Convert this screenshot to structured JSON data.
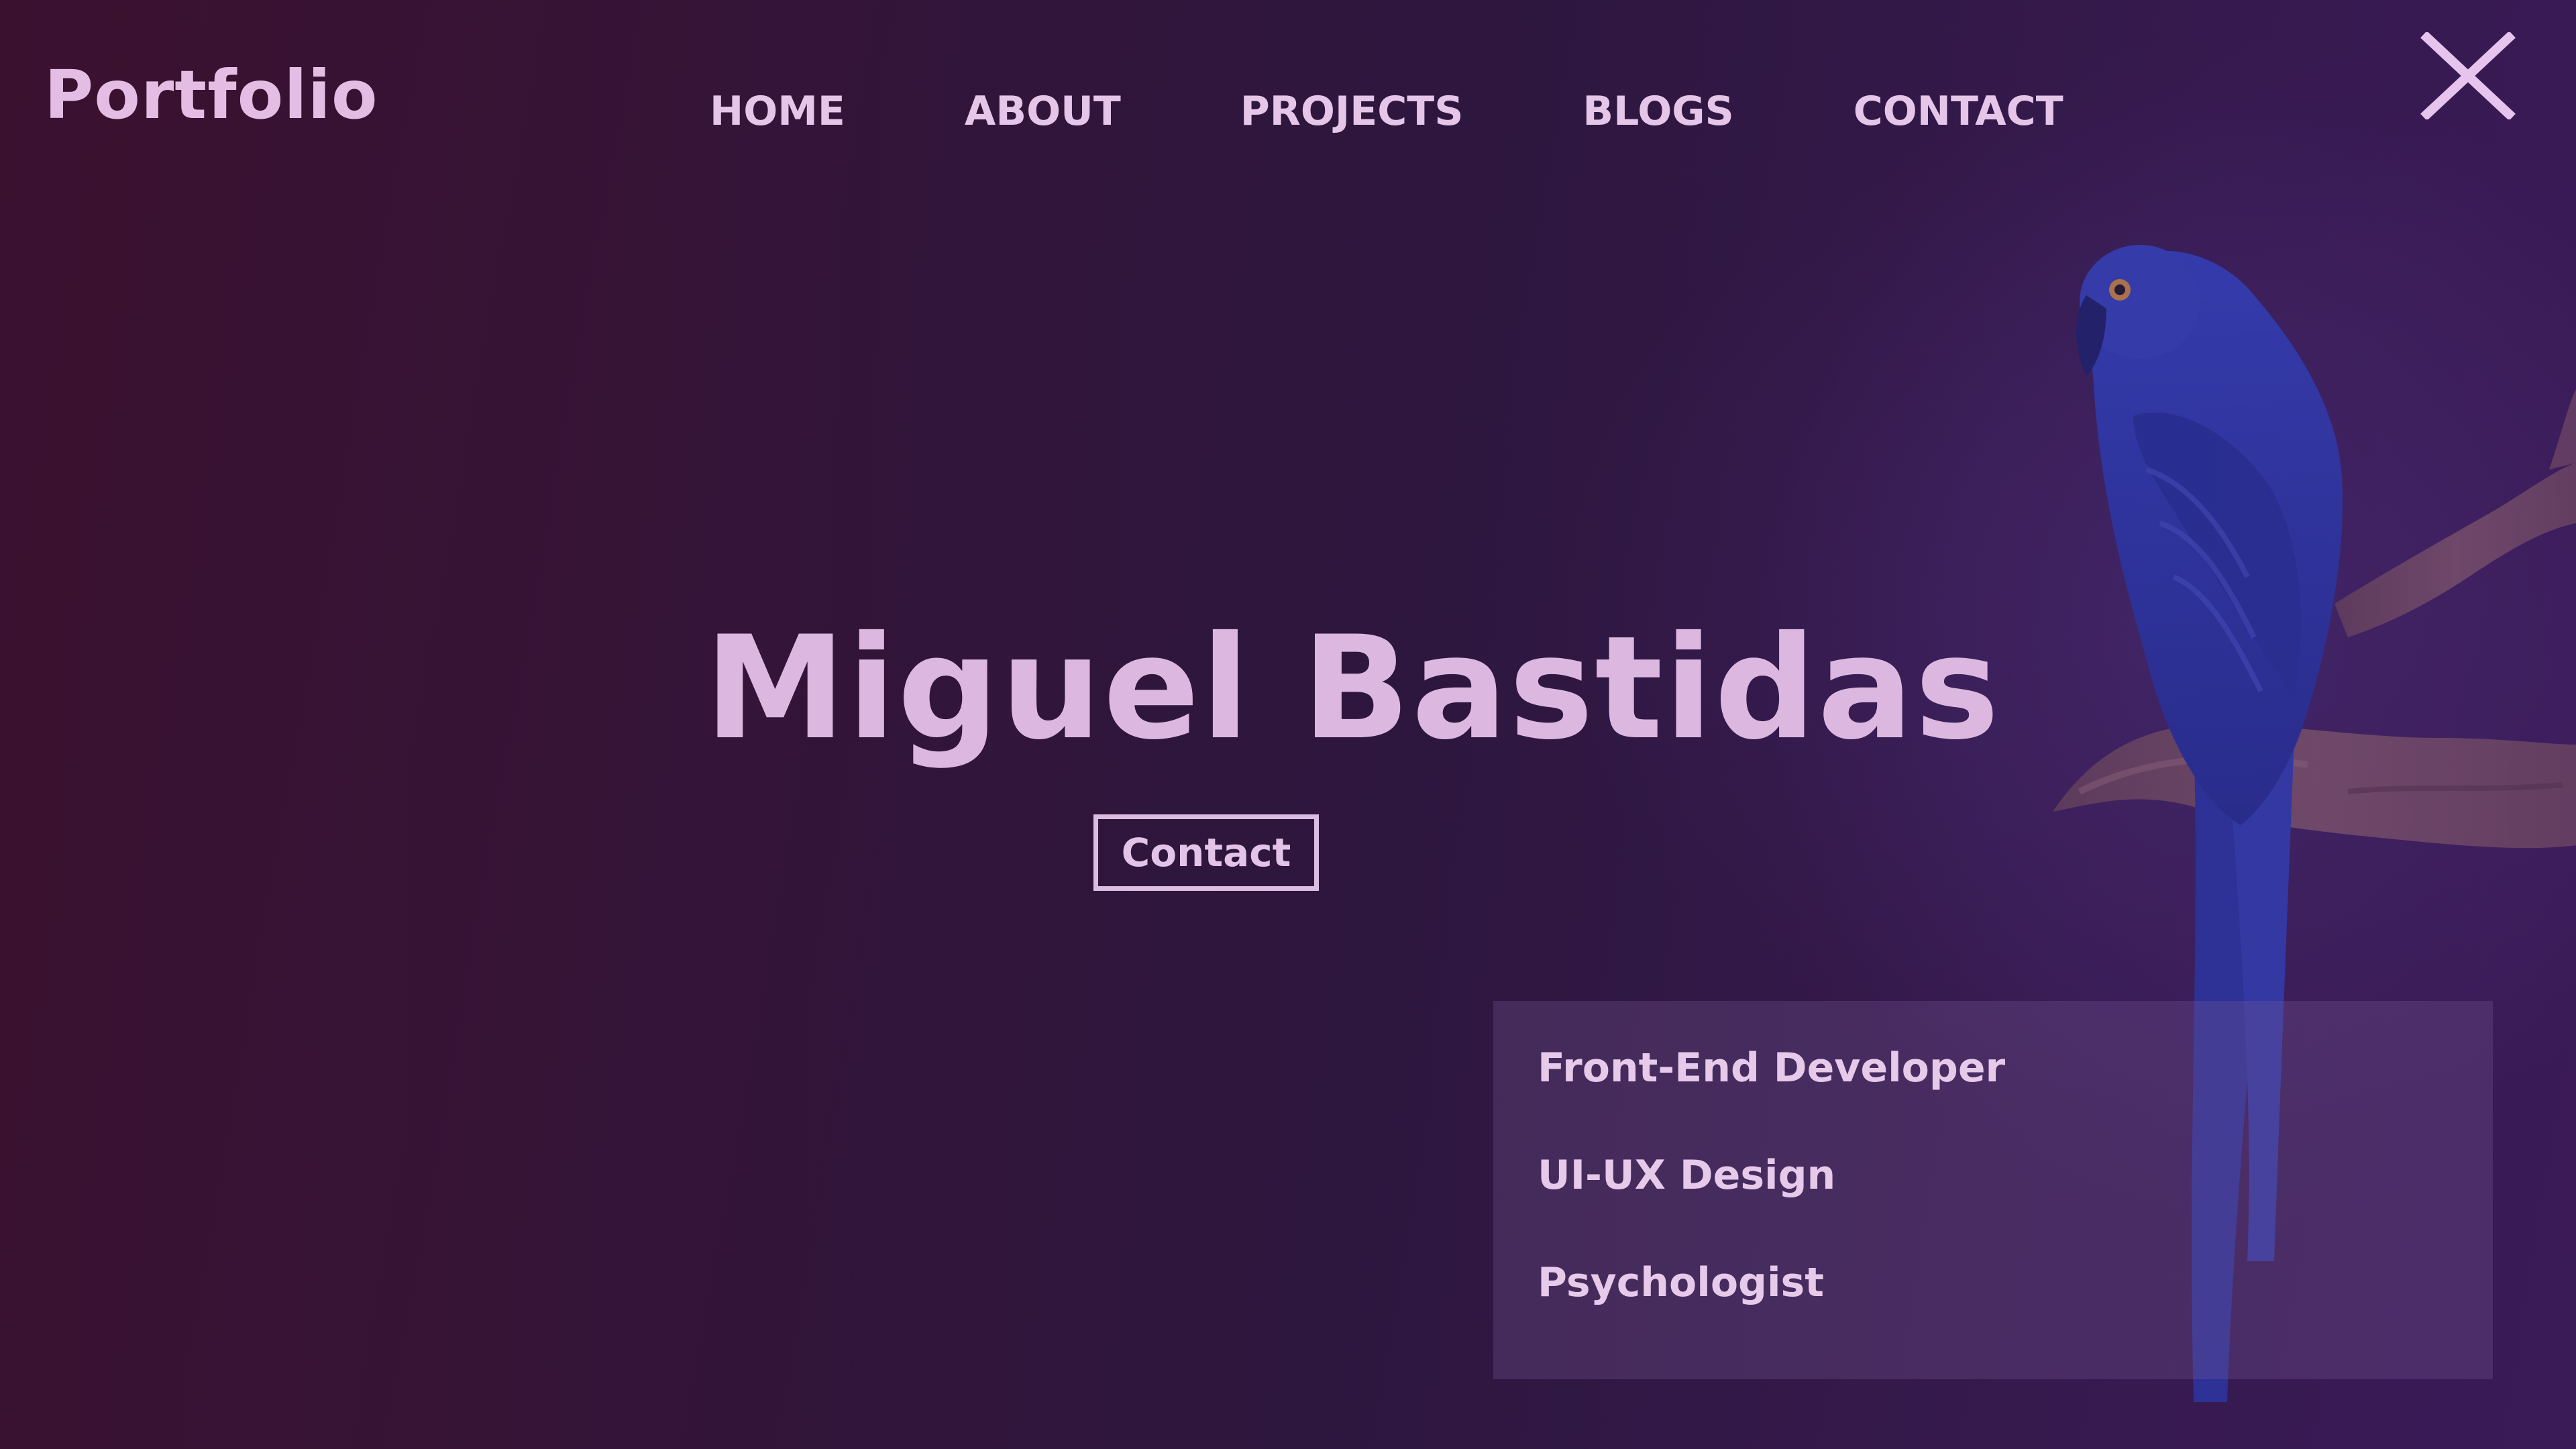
{
  "header": {
    "logo": "Portfolio",
    "nav": [
      "HOME",
      "ABOUT",
      "PROJECTS",
      "BLOGS",
      "CONTACT"
    ],
    "close_icon": "close-icon"
  },
  "hero": {
    "name": "Miguel Bastidas",
    "contact_button": "Contact"
  },
  "roles": [
    "Front-End Developer",
    "UI-UX Design",
    "Psychologist"
  ],
  "colors": {
    "background": "#2d173e",
    "text": "#e3bde3",
    "accent": "#dcb8e0",
    "parrot": "#2f3fb8"
  },
  "icons": {
    "close": "close-icon"
  }
}
